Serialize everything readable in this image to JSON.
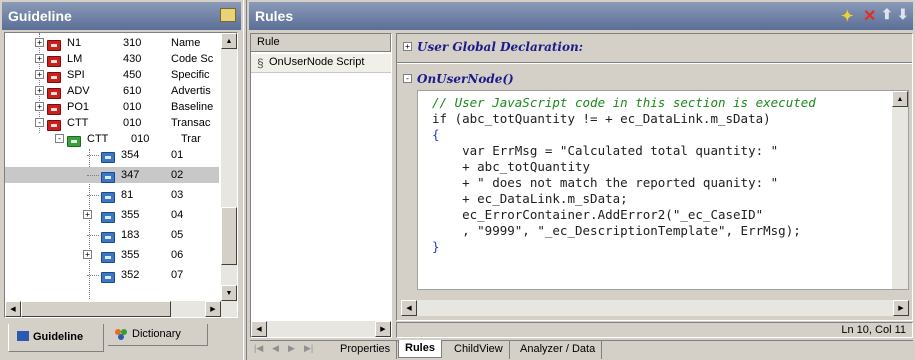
{
  "left_panel": {
    "title": "Guideline",
    "tree": [
      {
        "code": "N1",
        "num": "310",
        "desc": "Name",
        "folder": "red",
        "expander": "+"
      },
      {
        "code": "LM",
        "num": "430",
        "desc": "Code Sc",
        "folder": "red",
        "expander": "+"
      },
      {
        "code": "SPI",
        "num": "450",
        "desc": "Specific",
        "folder": "red",
        "expander": "+"
      },
      {
        "code": "ADV",
        "num": "610",
        "desc": "Advertis",
        "folder": "red",
        "expander": "+"
      },
      {
        "code": "PO1",
        "num": "010",
        "desc": "Baseline",
        "folder": "red",
        "expander": "+"
      },
      {
        "code": "CTT",
        "num": "010",
        "desc": "Transac",
        "folder": "red",
        "expander": "-"
      }
    ],
    "subgroup": {
      "code": "CTT",
      "num": "010",
      "desc": "Trar"
    },
    "children": [
      {
        "code": "354",
        "num": "01",
        "expander": ""
      },
      {
        "code": "347",
        "num": "02",
        "expander": "",
        "selected": true
      },
      {
        "code": "81",
        "num": "03",
        "expander": ""
      },
      {
        "code": "355",
        "num": "04",
        "expander": "+"
      },
      {
        "code": "183",
        "num": "05",
        "expander": ""
      },
      {
        "code": "355",
        "num": "06",
        "expander": "+"
      },
      {
        "code": "352",
        "num": "07",
        "expander": ""
      }
    ],
    "tabs": {
      "guideline": "Guideline",
      "dictionary": "Dictionary"
    }
  },
  "rules_panel": {
    "title": "Rules",
    "column_header": "Rule",
    "items": [
      "OnUserNode Script"
    ]
  },
  "editor": {
    "sections": [
      {
        "expander": "+",
        "label": "User Global Declaration:"
      },
      {
        "expander": "-",
        "label": "OnUserNode()"
      }
    ],
    "code_lines": [
      "// User JavaScript code in this section is executed",
      "",
      "if (abc_totQuantity != + ec_DataLink.m_sData)",
      "{",
      "    var ErrMsg = \"Calculated total quantity: \"",
      "    + abc_totQuantity",
      "    + \" does not match the reported quanity: \"",
      "    + ec_DataLink.m_sData;",
      "    ec_ErrorContainer.AddError2(\"_ec_CaseID\"",
      "    , \"9999\", \"_ec_DescriptionTemplate\", ErrMsg);",
      "}"
    ],
    "status": "Ln 10, Col 11"
  },
  "bottom_tabs": [
    "Properties",
    "Rules",
    "ChildView",
    "Analyzer / Data"
  ],
  "toolbar_icons": [
    "add-rule-icon",
    "delete-icon",
    "move-up-icon",
    "move-down-icon"
  ]
}
